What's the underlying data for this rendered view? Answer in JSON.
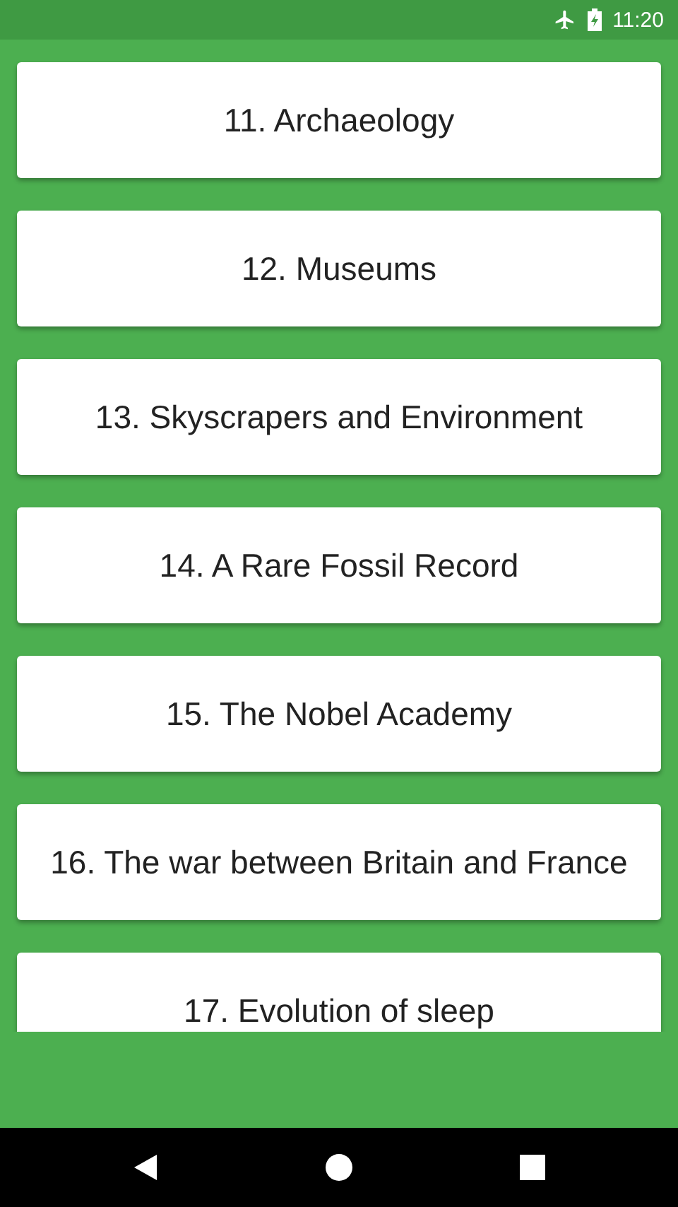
{
  "status_bar": {
    "time": "11:20"
  },
  "lessons": [
    {
      "title": "11. Archaeology"
    },
    {
      "title": "12. Museums"
    },
    {
      "title": "13. Skyscrapers and Environment"
    },
    {
      "title": "14. A Rare Fossil Record"
    },
    {
      "title": "15. The Nobel Academy"
    },
    {
      "title": "16. The war between Britain and France"
    },
    {
      "title": "17. Evolution of sleep"
    }
  ]
}
